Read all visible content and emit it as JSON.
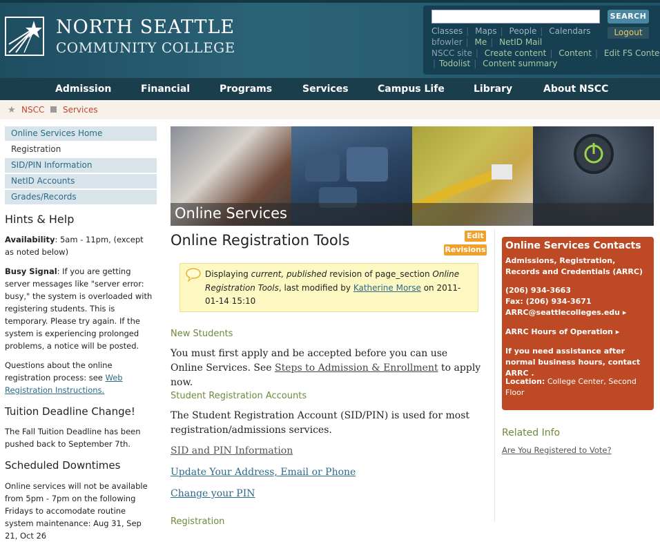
{
  "header": {
    "college_name": "NORTH SEATTLE",
    "college_sub": "COMMUNITY COLLEGE",
    "search_placeholder": "",
    "search_label": "SEARCH",
    "logout_label": "Logout",
    "row1": [
      "Classes",
      "Maps",
      "People",
      "Calendars"
    ],
    "row2": {
      "user": "bfowler",
      "links": [
        "Me",
        "NetID Mail"
      ]
    },
    "row3": {
      "site": "NSCC site",
      "links": [
        "Create content",
        "Content",
        "Edit FS Content"
      ]
    },
    "row4": [
      "Todolist",
      "Content summary"
    ]
  },
  "nav": [
    "Admission",
    "Financial",
    "Programs",
    "Services",
    "Campus Life",
    "Library",
    "About NSCC"
  ],
  "breadcrumb": [
    "NSCC",
    "Services"
  ],
  "sidebar": {
    "items": [
      "Online Services Home",
      "Registration",
      "SID/PIN Information",
      "NetID Accounts",
      "Grades/Records"
    ],
    "hints_title": "Hints & Help",
    "availability_label": "Availability",
    "availability_text": ": 5am - 11pm, (except as noted below)",
    "busy_label": "Busy Signal",
    "busy_text": ": If you are getting server messages like \"server error: busy,\" the system is overloaded with registering students. This is temporary. Please try again. If the system is experiencing prolonged problems, a notice will be posted.",
    "questions_text": "Questions about the online registration process: see ",
    "questions_link": "Web Registration Instructions.",
    "tuition_title": "Tuition Deadline Change!",
    "tuition_text": "The Fall Tuition Deadline has been pushed back to September 7th.",
    "downtime_title": "Scheduled Downtimes",
    "downtime_text": "Online services will not be available from 5pm - 7pm on the following Fridays to accomodate routine system maintenance: Aug 31, Sep 21, Oct 26"
  },
  "banner": {
    "title": "Online Services"
  },
  "main": {
    "edit_label": "Edit",
    "revisions_label": "Revisions",
    "title": "Online Registration Tools",
    "notice": {
      "p1": "Displaying ",
      "em1": "current, published",
      "p2": " revision of page_section ",
      "em2": "Online Registration Tools",
      "p3": ", last modified by ",
      "author": "Katherine Morse",
      "p4": " on 2011-01-14 15:10"
    },
    "new_students_h": "New Students",
    "new_students_p1": "You must first apply and be accepted before you can use Online Services. See ",
    "new_students_link": "Steps to Admission & Enrollment",
    "new_students_p2": " to apply now.",
    "accounts_h": "Student Registration Accounts",
    "accounts_p": "The Student Registration Account (SID/PIN) is used for most registration/admissions services.",
    "links": [
      "SID and PIN Information",
      "Update Your Address, Email or Phone",
      "Change your PIN"
    ],
    "registration_h": "Registration"
  },
  "contacts": {
    "title": "Online Services Contacts",
    "dept": "Admissions, Registration, Records and Credentials (ARRC)",
    "phone": "(206) 934-3663",
    "fax": "Fax: (206) 934-3671",
    "email": "ARRC@seattlecolleges.edu",
    "hours": "ARRC Hours of Operation",
    "assist": "If you need assistance after normal business hours, contact ARRC .",
    "location_label": "Location:",
    "location": " College Center, Second Floor"
  },
  "related": {
    "title": "Related Info",
    "link": "Are You Registered to Vote?"
  }
}
